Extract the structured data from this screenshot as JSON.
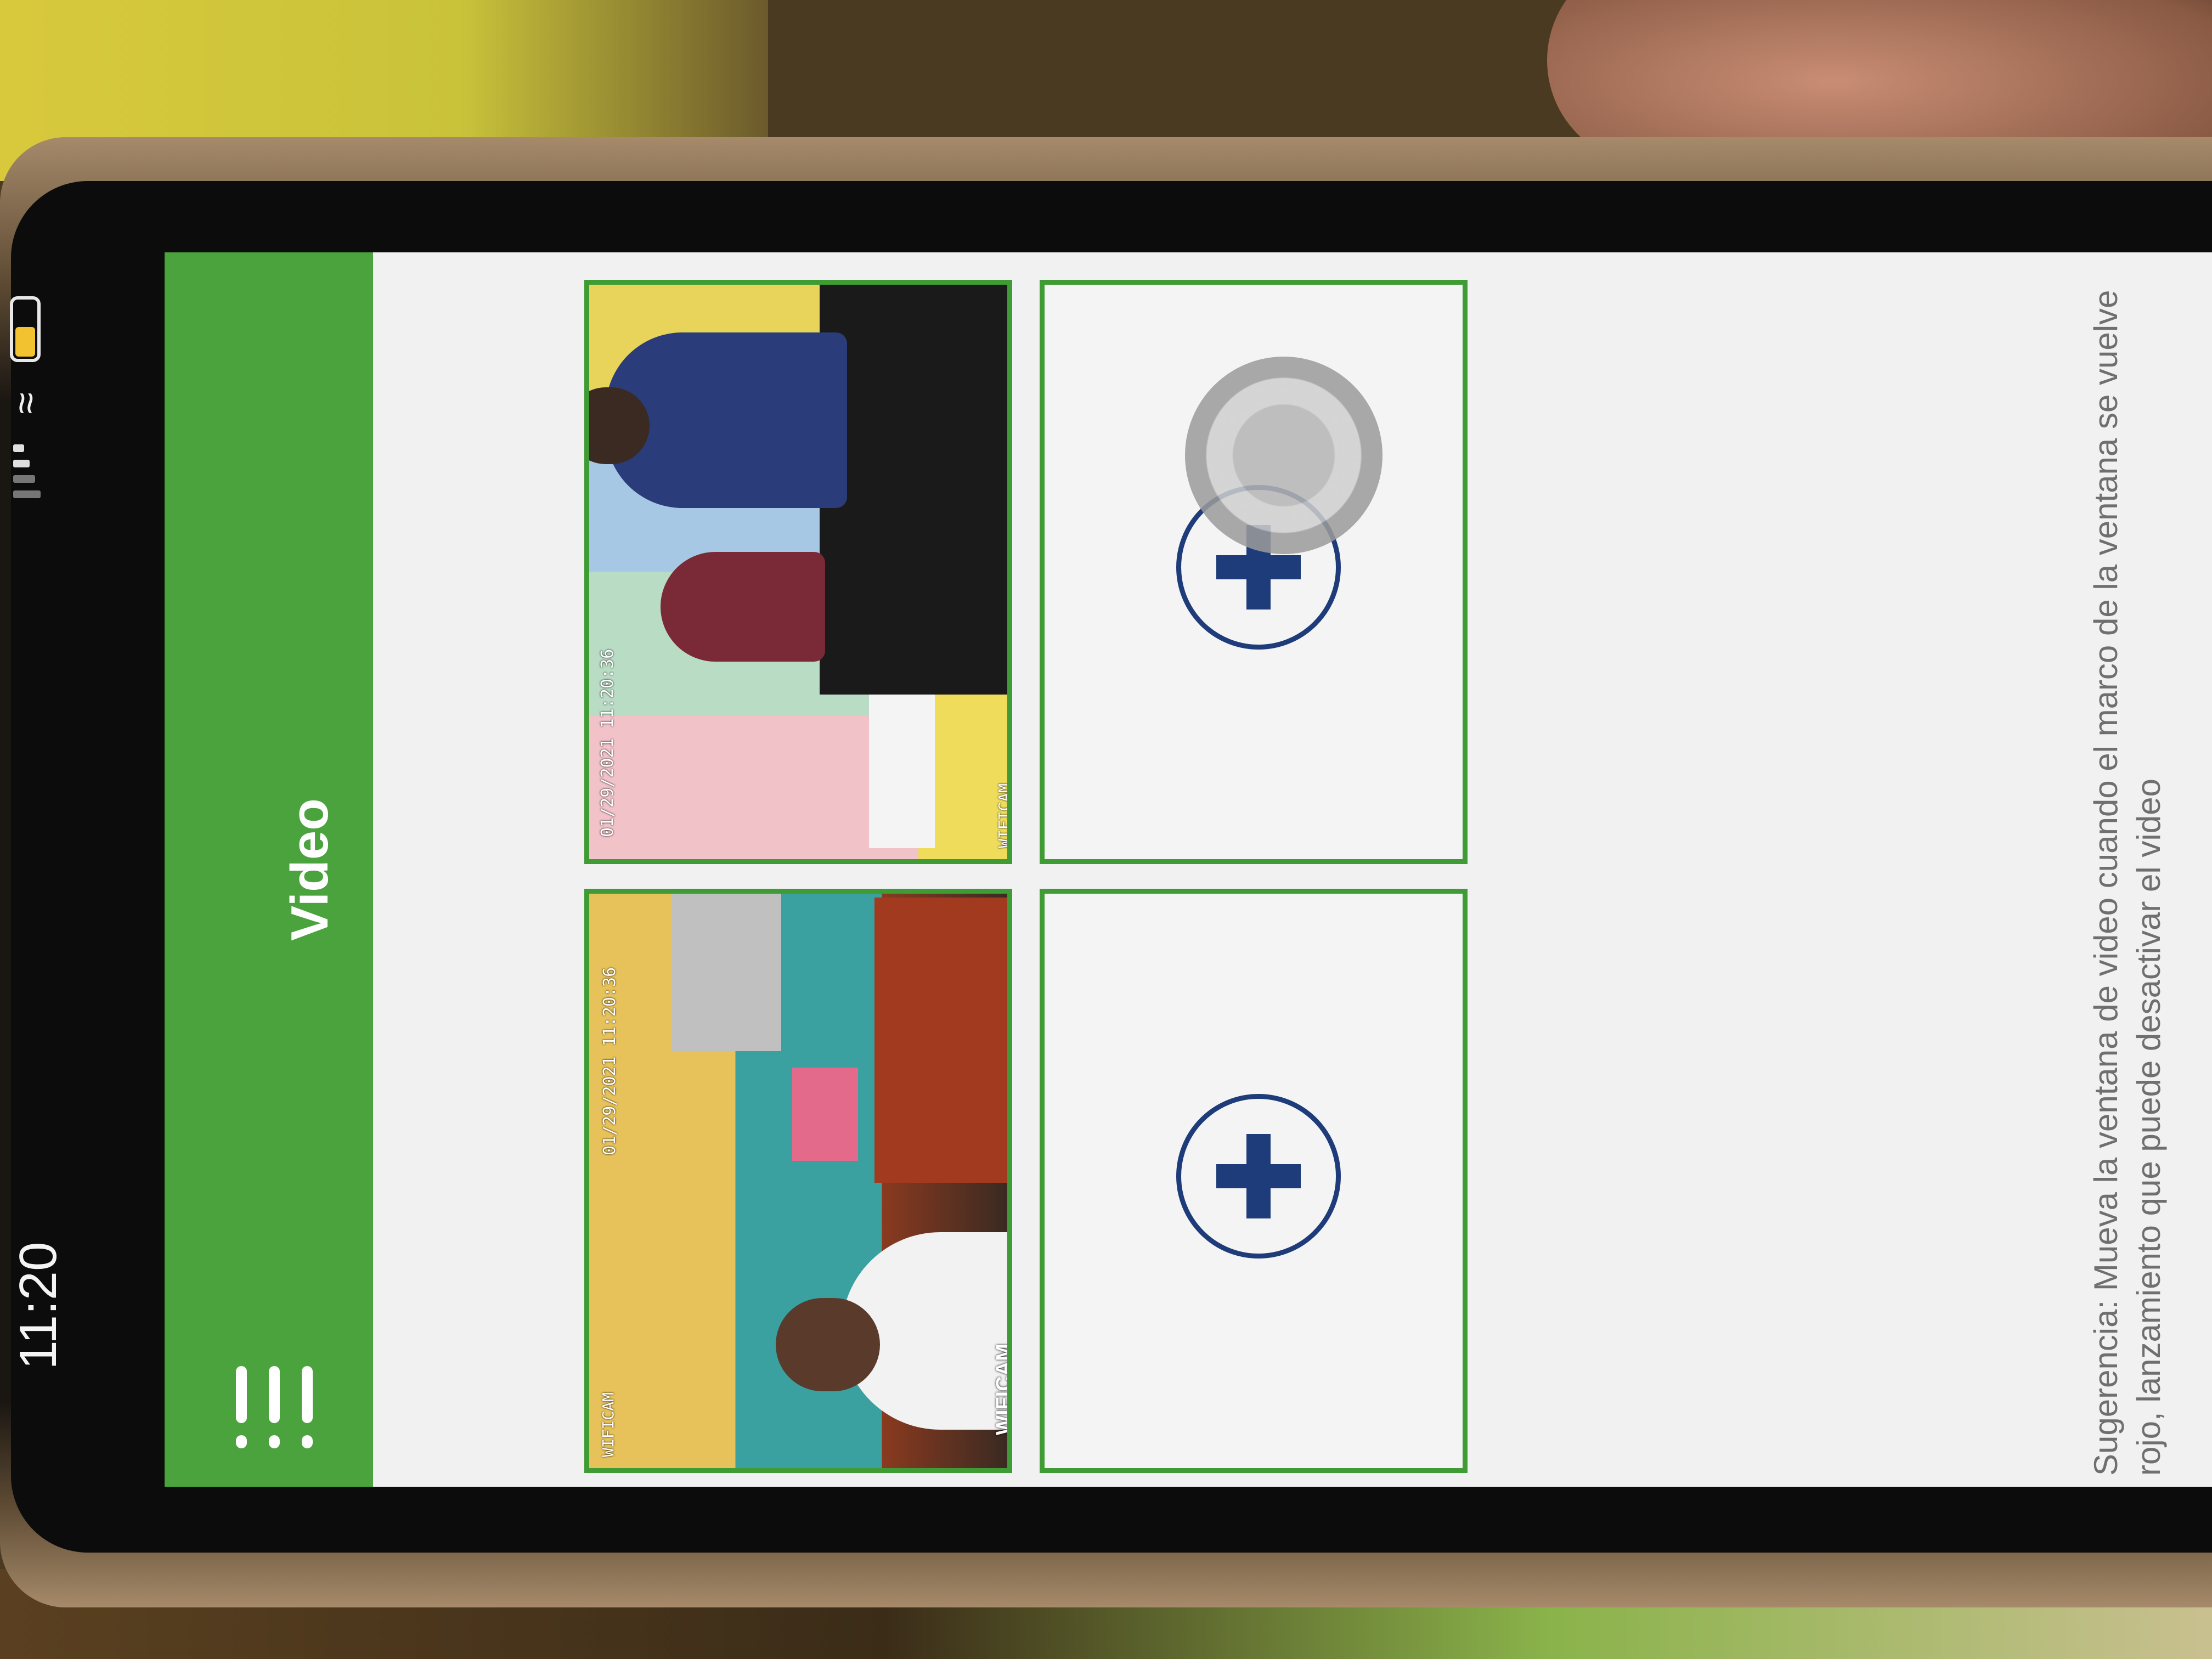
{
  "status_bar": {
    "time": "11:20",
    "battery_level": 0.5,
    "battery_color": "#f2c230"
  },
  "header": {
    "title": "Video",
    "menu_icon": "menu-icon",
    "background_color": "#4aa33c"
  },
  "grid": {
    "tiles": [
      {
        "type": "video",
        "timestamp": "01/29/2021 11:20:36",
        "camera_label": "WIFICAM",
        "overlay_text": "WIFICAM"
      },
      {
        "type": "video",
        "timestamp": "01/29/2021 11:20:36",
        "camera_label": "WIFICAM"
      },
      {
        "type": "empty",
        "icon": "add-circle-icon"
      },
      {
        "type": "empty",
        "icon": "add-circle-icon"
      }
    ],
    "border_color": "#3f9b33",
    "add_icon_color": "#1f3c7a"
  },
  "hint": {
    "text": "Sugerencia: Mueva la ventana de video cuando el marco de la ventana se vuelve rojo, lanzamiento que puede desactivar el video"
  }
}
